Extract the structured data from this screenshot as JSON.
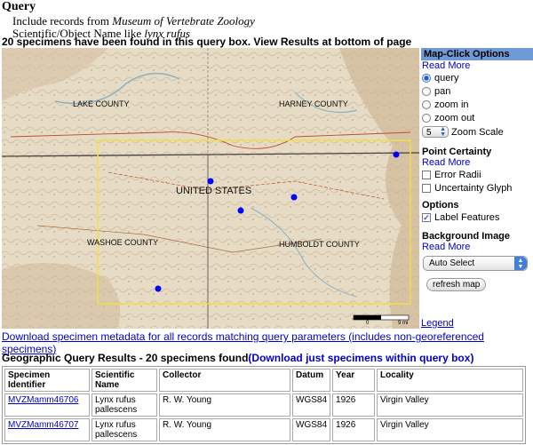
{
  "query": {
    "title": "Query",
    "line1_prefix": "Include records from ",
    "line1_em": "Museum of Vertebrate Zoology",
    "line2_prefix": "Scientific/Object Name like ",
    "line2_em": "lynx rufus",
    "found": "20 specimens have been found in this query box.  View Results at bottom of page"
  },
  "map": {
    "labels": {
      "lake": "LAKE COUNTY",
      "harney": "HARNEY COUNTY",
      "us": "UNITED STATES",
      "washoe": "WASHOE COUNTY",
      "humboldt": "HUMBOLDT COUNTY"
    },
    "scale_left": "0",
    "scale_right": "9 mi",
    "point_color": "#0000ff",
    "box_color": "#f2e040"
  },
  "sidebar": {
    "header": "Map-Click Options",
    "read_more": "Read More",
    "modes": [
      "query",
      "pan",
      "zoom in",
      "zoom out"
    ],
    "selected_mode": "query",
    "zoom_value": "5",
    "zoom_label": "Zoom Scale",
    "certainty_title": "Point Certainty",
    "certainty_read_more": "Read More",
    "error_radii": "Error Radii",
    "uncertainty_glyph": "Uncertainty Glyph",
    "options_title": "Options",
    "label_features": "Label Features",
    "background_title": "Background Image",
    "background_read_more": "Read More",
    "background_select": "Auto Select",
    "refresh": "refresh map",
    "legend": "Legend"
  },
  "download_all": "Download specimen metadata for all records matching query parameters (includes non-georeferenced specimens)",
  "results": {
    "title": "Geographic Query Results - 20 specimens found",
    "download_link": "(Download just specimens within query box)",
    "columns": [
      "Specimen Identifier",
      "Scientific Name",
      "Collector",
      "Datum",
      "Year",
      "Locality"
    ],
    "rows": [
      {
        "id": "MVZMamm46706",
        "name": "Lynx rufus pallescens",
        "collector": "R. W. Young",
        "datum": "WGS84",
        "year": "1926",
        "locality": "Virgin Valley"
      },
      {
        "id": "MVZMamm46707",
        "name": "Lynx rufus pallescens",
        "collector": "R. W. Young",
        "datum": "WGS84",
        "year": "1926",
        "locality": "Virgin Valley"
      }
    ]
  }
}
